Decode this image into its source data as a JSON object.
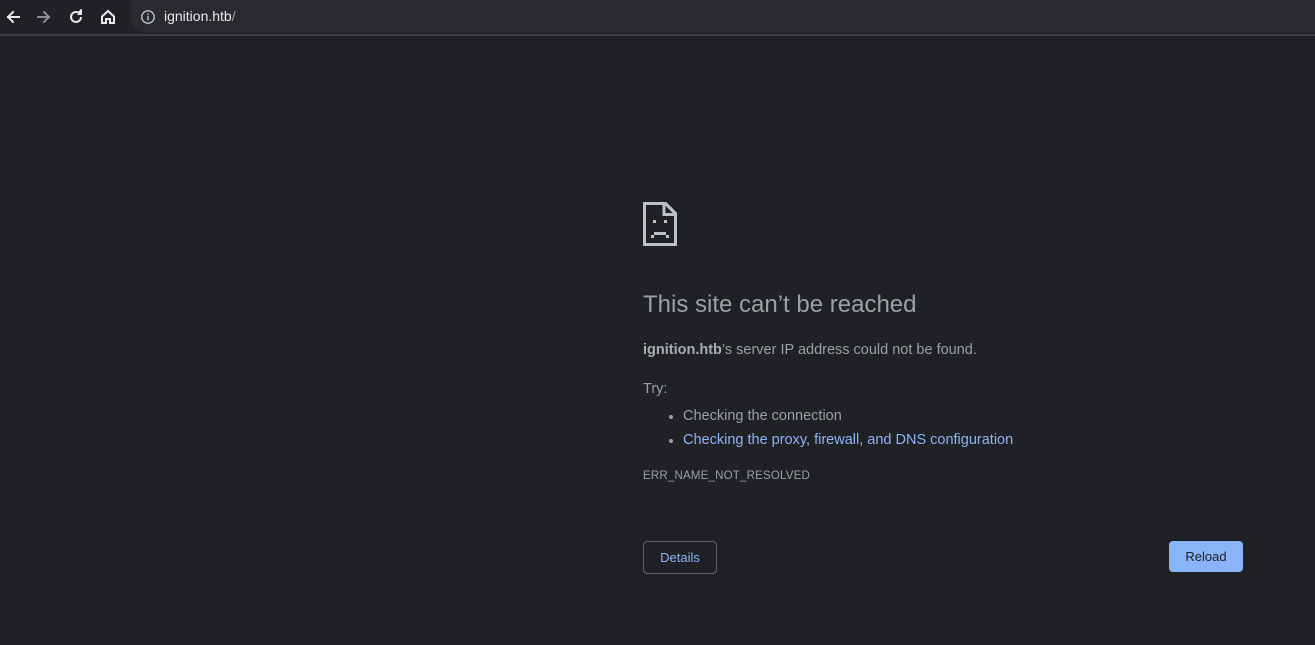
{
  "toolbar": {
    "back_icon": "arrow-left-icon",
    "forward_icon": "arrow-right-icon",
    "reload_icon": "reload-icon",
    "home_icon": "home-icon"
  },
  "omnibox": {
    "info_icon": "info-icon",
    "url_host": "ignition.htb",
    "url_path": "/"
  },
  "error_page": {
    "icon": "sad-document-icon",
    "title": "This site can’t be reached",
    "desc_host": "ignition.htb",
    "desc_rest": "’s server IP address could not be found.",
    "try_label": "Try:",
    "suggestions": [
      "Checking the connection",
      "Checking the proxy, firewall, and DNS configuration"
    ],
    "error_code": "ERR_NAME_NOT_RESOLVED",
    "details_label": "Details",
    "reload_label": "Reload"
  },
  "colors": {
    "background": "#202124",
    "text_secondary": "#9aa0a6",
    "link": "#8ab4f8",
    "reload_button": "#8ab4f8"
  }
}
